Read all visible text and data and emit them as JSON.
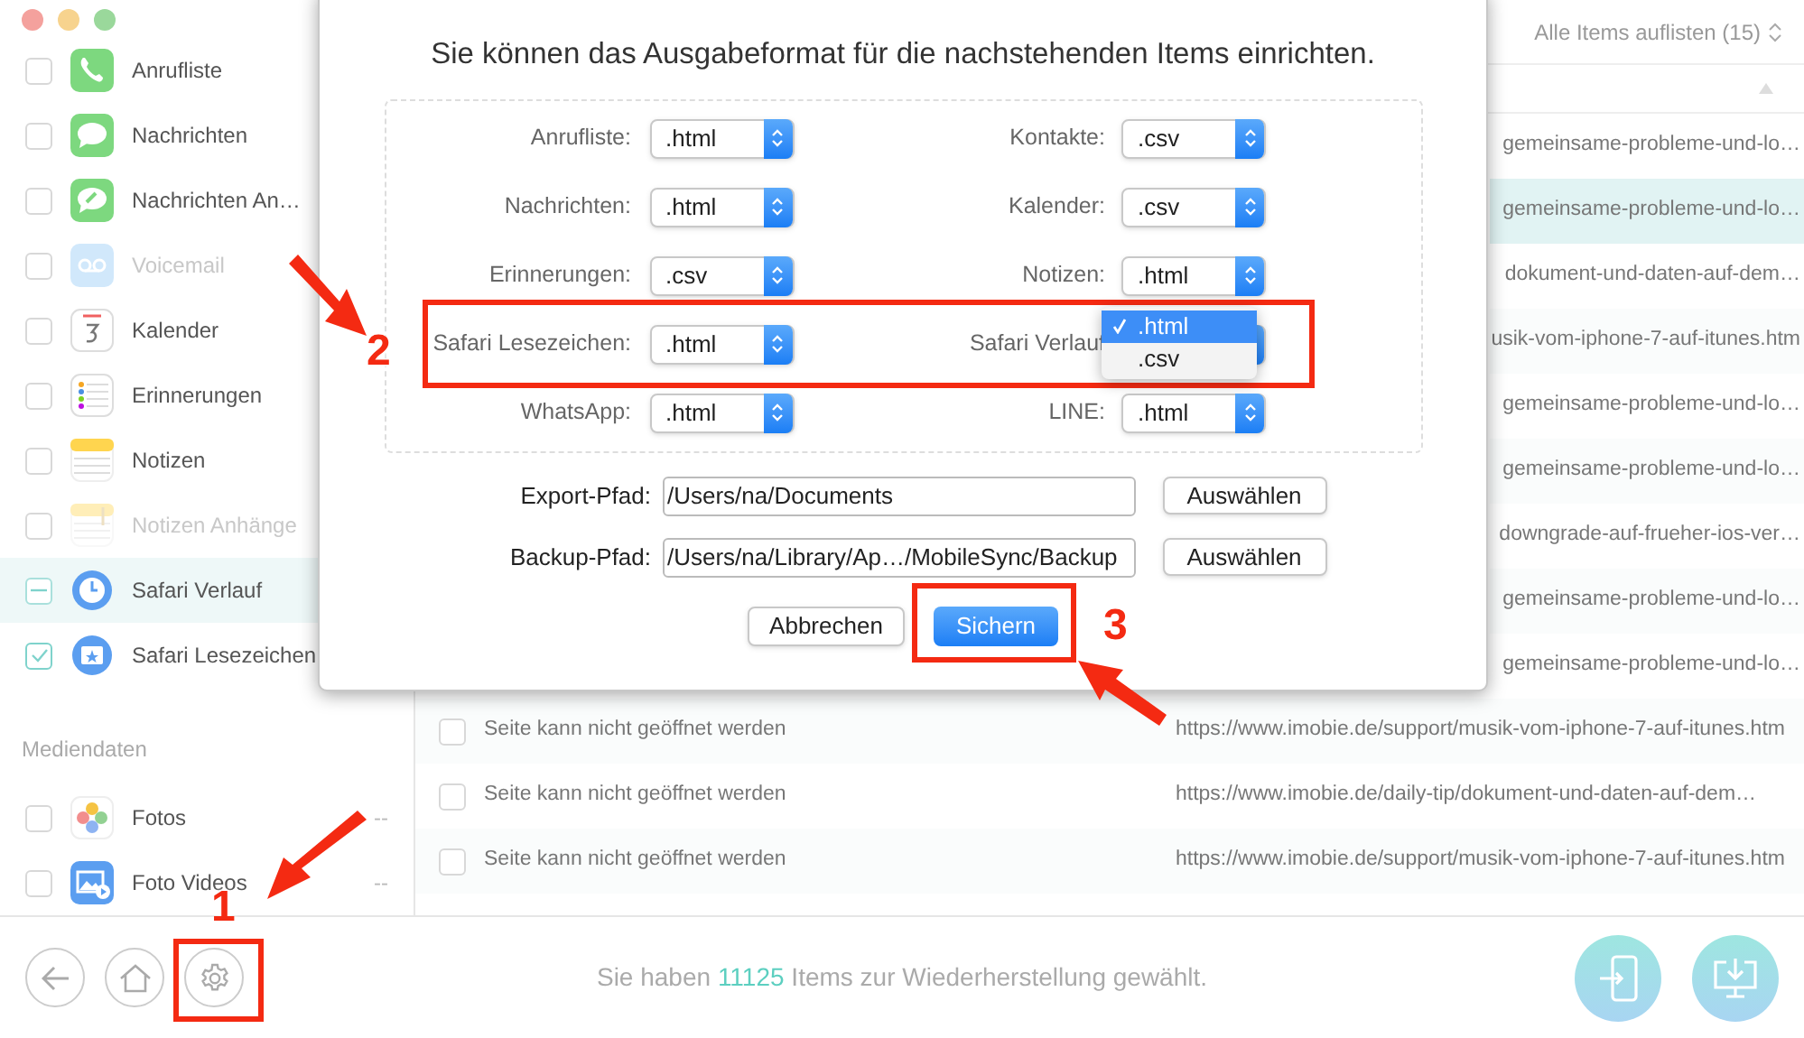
{
  "sidebar": {
    "items": [
      {
        "label": "Anrufliste",
        "checked": false,
        "disabled": false,
        "selected": false
      },
      {
        "label": "Nachrichten",
        "checked": false,
        "disabled": false,
        "selected": false
      },
      {
        "label": "Nachrichten An…",
        "checked": false,
        "disabled": false,
        "selected": false
      },
      {
        "label": "Voicemail",
        "checked": false,
        "disabled": true,
        "selected": false
      },
      {
        "label": "Kalender",
        "checked": false,
        "disabled": false,
        "selected": false
      },
      {
        "label": "Erinnerungen",
        "checked": false,
        "disabled": false,
        "selected": false
      },
      {
        "label": "Notizen",
        "checked": false,
        "disabled": false,
        "selected": false
      },
      {
        "label": "Notizen Anhänge",
        "checked": false,
        "disabled": true,
        "selected": false
      },
      {
        "label": "Safari Verlauf",
        "checked": false,
        "mixed": true,
        "disabled": false,
        "selected": true
      },
      {
        "label": "Safari Lesezeichen",
        "checked": true,
        "disabled": false,
        "selected": false
      }
    ],
    "section": "Mediendaten",
    "media_items": [
      {
        "label": "Fotos",
        "checked": false,
        "count": "--"
      },
      {
        "label": "Foto Videos",
        "checked": false,
        "count": "--"
      }
    ]
  },
  "list": {
    "filter": "Alle Items auflisten (15)",
    "rows": [
      {
        "url": "gemeinsame-probleme-und-lo…",
        "selected": false
      },
      {
        "url": "gemeinsame-probleme-und-lo…",
        "selected": true
      },
      {
        "url": "dokument-und-daten-auf-dem…",
        "selected": false
      },
      {
        "url": "usik-vom-iphone-7-auf-itunes.htm",
        "selected": false
      },
      {
        "url": "gemeinsame-probleme-und-lo…",
        "selected": false
      },
      {
        "url": "gemeinsame-probleme-und-lo…",
        "selected": false
      },
      {
        "url": "downgrade-auf-frueher-ios-ver…",
        "selected": false
      },
      {
        "url": "gemeinsame-probleme-und-lo…",
        "selected": false
      },
      {
        "url": "gemeinsame-probleme-und-lo…",
        "selected": false
      },
      {
        "title": "Seite kann nicht geöffnet werden",
        "url": "https://www.imobie.de/support/musik-vom-iphone-7-auf-itunes.htm",
        "checked": false,
        "selected": false
      },
      {
        "title": "Seite kann nicht geöffnet werden",
        "url": "https://www.imobie.de/daily-tip/dokument-und-daten-auf-dem…",
        "checked": false,
        "selected": false
      },
      {
        "title": "Seite kann nicht geöffnet werden",
        "url": "https://www.imobie.de/support/musik-vom-iphone-7-auf-itunes.htm",
        "checked": false,
        "selected": false
      }
    ]
  },
  "dialog": {
    "title": "Sie können das Ausgabeformat für die nachstehenden Items einrichten.",
    "format_rows": [
      {
        "cells": [
          {
            "label": "Anrufliste:",
            "value": ".html"
          },
          {
            "label": "Kontakte:",
            "value": ".csv"
          }
        ]
      },
      {
        "cells": [
          {
            "label": "Nachrichten:",
            "value": ".html"
          },
          {
            "label": "Kalender:",
            "value": ".csv"
          }
        ]
      },
      {
        "cells": [
          {
            "label": "Erinnerungen:",
            "value": ".csv"
          },
          {
            "label": "Notizen:",
            "value": ".html"
          }
        ]
      },
      {
        "cells": [
          {
            "label": "Safari Lesezeichen:",
            "value": ".html"
          },
          {
            "label": "Safari Verlauf",
            "open": true,
            "options": [
              {
                "label": ".html",
                "selected": true
              },
              {
                "label": ".csv",
                "selected": false
              }
            ]
          }
        ]
      },
      {
        "cells": [
          {
            "label": "WhatsApp:",
            "value": ".html"
          },
          {
            "label": "LINE:",
            "value": ".html"
          }
        ]
      }
    ],
    "paths": [
      {
        "label": "Export-Pfad:",
        "value": "/Users/na/Documents",
        "button": "Auswählen"
      },
      {
        "label": "Backup-Pfad:",
        "value": "/Users/na/Library/Ap…/MobileSync/Backup",
        "button": "Auswählen"
      }
    ],
    "cancel": "Abbrechen",
    "save": "Sichern"
  },
  "status": {
    "before": "Sie haben",
    "count": "11125",
    "after": "Items zur Wiederherstellung gewählt."
  },
  "annotations": [
    "1",
    "2",
    "3"
  ]
}
